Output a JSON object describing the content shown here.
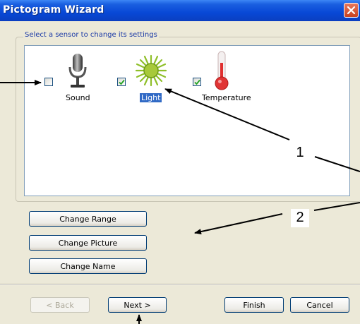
{
  "window": {
    "title": "Pictogram Wizard"
  },
  "group": {
    "legend": "Select a sensor to change its settings"
  },
  "sensors": [
    {
      "label": "Sound",
      "checked": false,
      "icon": "microphone-icon",
      "selected": false
    },
    {
      "label": "Light",
      "checked": true,
      "icon": "sun-icon",
      "selected": true
    },
    {
      "label": "Temperature",
      "checked": true,
      "icon": "thermometer-icon",
      "selected": false
    }
  ],
  "side_buttons": {
    "change_range": "Change Range",
    "change_picture": "Change Picture",
    "change_name": "Change Name"
  },
  "footer": {
    "back": "< Back",
    "next": "Next >",
    "finish": "Finish",
    "cancel": "Cancel"
  },
  "annotations": {
    "callout_1": "1",
    "callout_2": "2"
  },
  "colors": {
    "titlebar": "#0848d6",
    "selection": "#316ac5",
    "legend_text": "#1b3aa6"
  }
}
